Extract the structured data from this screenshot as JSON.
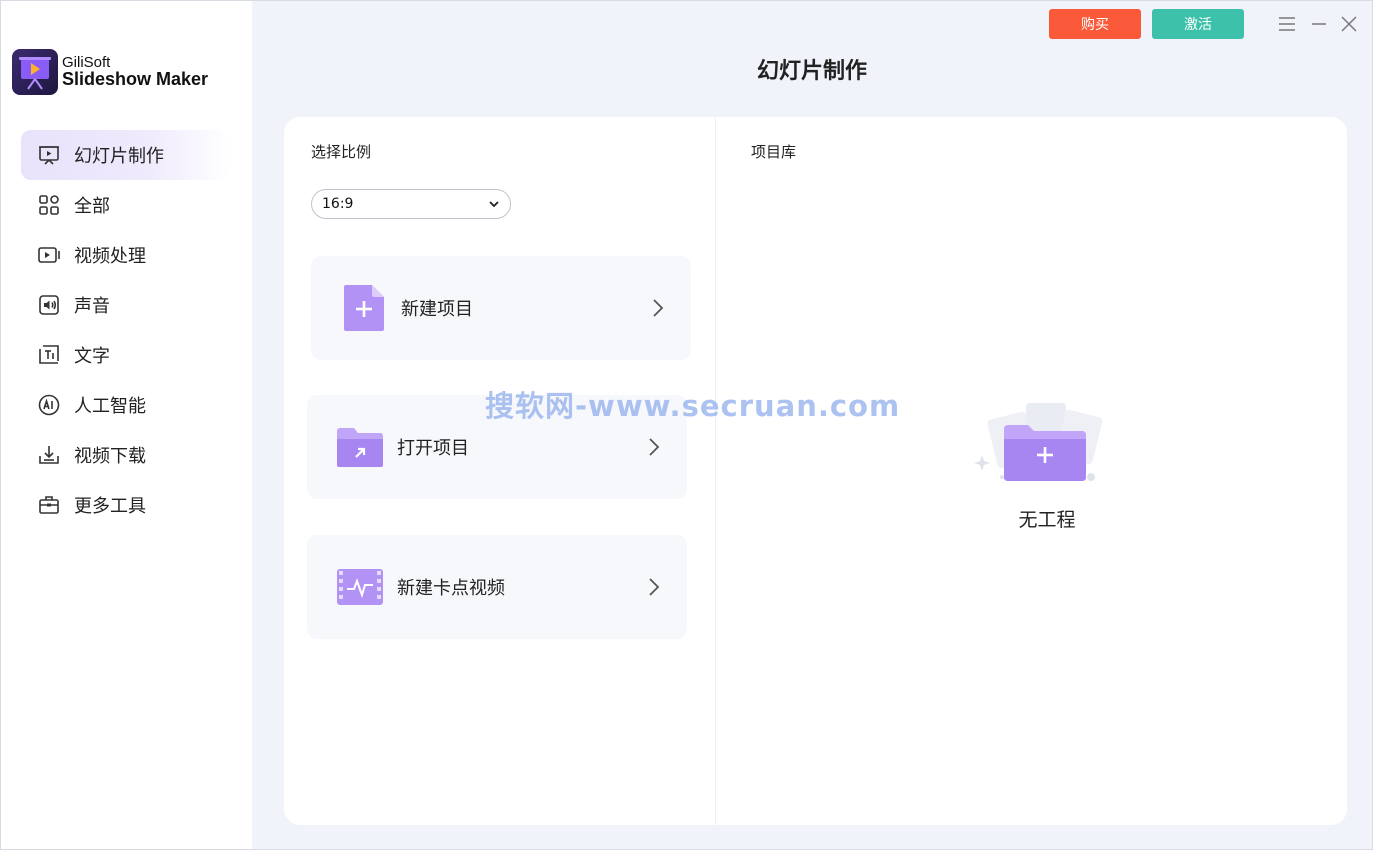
{
  "app": {
    "brand_small": "GiliSoft",
    "brand_big": "Slideshow Maker",
    "page_title": "幻灯片制作"
  },
  "topbar": {
    "buy_label": "购买",
    "activate_label": "激活",
    "buy_color": "#fa5a3a",
    "activate_color": "#3dc1ab"
  },
  "sidebar": {
    "items": [
      {
        "label": "幻灯片制作",
        "icon": "slideshow-icon",
        "active": true
      },
      {
        "label": "全部",
        "icon": "grid-icon",
        "active": false
      },
      {
        "label": "视频处理",
        "icon": "video-play-icon",
        "active": false
      },
      {
        "label": "声音",
        "icon": "speaker-icon",
        "active": false
      },
      {
        "label": "文字",
        "icon": "text-icon",
        "active": false
      },
      {
        "label": "人工智能",
        "icon": "ai-icon",
        "active": false
      },
      {
        "label": "视频下载",
        "icon": "download-icon",
        "active": false
      },
      {
        "label": "更多工具",
        "icon": "toolbox-icon",
        "active": false
      }
    ]
  },
  "left_panel": {
    "ratio_label": "选择比例",
    "ratio_value": "16:9",
    "cards": [
      {
        "label": "新建项目",
        "icon": "new-file-icon"
      },
      {
        "label": "打开项目",
        "icon": "open-folder-icon"
      },
      {
        "label": "新建卡点视频",
        "icon": "beat-video-icon"
      }
    ]
  },
  "right_panel": {
    "library_label": "项目库",
    "empty_text": "无工程"
  },
  "watermark": "搜软网-www.secruan.com",
  "accent_color": "#a685f0"
}
